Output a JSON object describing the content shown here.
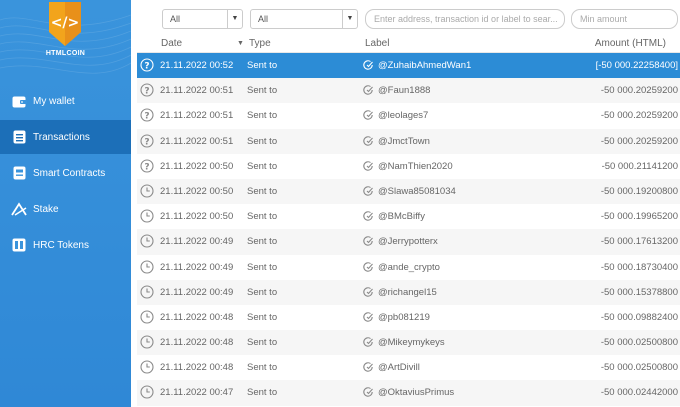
{
  "app": {
    "brand": "HTMLCOIN",
    "accent": "#2f88d6",
    "selected_row_color": "#2c8cd6"
  },
  "sidebar": {
    "items": [
      {
        "label": "My wallet",
        "icon": "wallet-icon"
      },
      {
        "label": "Transactions",
        "icon": "transactions-icon",
        "active": true
      },
      {
        "label": "Smart Contracts",
        "icon": "smart-contracts-icon"
      },
      {
        "label": "Stake",
        "icon": "stake-icon"
      },
      {
        "label": "HRC Tokens",
        "icon": "tokens-icon"
      }
    ]
  },
  "filters": {
    "date_filter": "All",
    "type_filter": "All",
    "search_placeholder": "Enter address, transaction id or label to sear...",
    "min_amount_placeholder": "Min amount"
  },
  "table": {
    "columns": {
      "date": "Date",
      "type": "Type",
      "label": "Label",
      "amount": "Amount (HTML)"
    },
    "rows": [
      {
        "status": "unconfirmed-icon",
        "date": "21.11.2022 00:52",
        "type": "Sent to",
        "label": "@ZuhaibAhmedWan1",
        "amount": "[-50 000.22258400]",
        "selected": true
      },
      {
        "status": "unconfirmed-icon",
        "date": "21.11.2022 00:51",
        "type": "Sent to",
        "label": "@Faun1888",
        "amount": "-50 000.20259200"
      },
      {
        "status": "unconfirmed-icon",
        "date": "21.11.2022 00:51",
        "type": "Sent to",
        "label": "@leolages7",
        "amount": "-50 000.20259200"
      },
      {
        "status": "unconfirmed-icon",
        "date": "21.11.2022 00:51",
        "type": "Sent to",
        "label": "@JmctTown",
        "amount": "-50 000.20259200"
      },
      {
        "status": "unconfirmed-icon",
        "date": "21.11.2022 00:50",
        "type": "Sent to",
        "label": "@NamThien2020",
        "amount": "-50 000.21141200"
      },
      {
        "status": "clock-icon",
        "date": "21.11.2022 00:50",
        "type": "Sent to",
        "label": "@Slawa85081034",
        "amount": "-50 000.19200800"
      },
      {
        "status": "clock-icon",
        "date": "21.11.2022 00:50",
        "type": "Sent to",
        "label": "@BMcBiffy",
        "amount": "-50 000.19965200"
      },
      {
        "status": "clock-icon",
        "date": "21.11.2022 00:49",
        "type": "Sent to",
        "label": "@Jerrypotterx",
        "amount": "-50 000.17613200"
      },
      {
        "status": "clock-icon",
        "date": "21.11.2022 00:49",
        "type": "Sent to",
        "label": "@ande_crypto",
        "amount": "-50 000.18730400"
      },
      {
        "status": "clock-icon",
        "date": "21.11.2022 00:49",
        "type": "Sent to",
        "label": "@richangel15",
        "amount": "-50 000.15378800"
      },
      {
        "status": "clock-icon",
        "date": "21.11.2022 00:48",
        "type": "Sent to",
        "label": "@pb081219",
        "amount": "-50 000.09882400"
      },
      {
        "status": "clock-icon",
        "date": "21.11.2022 00:48",
        "type": "Sent to",
        "label": "@Mikeymykeys",
        "amount": "-50 000.02500800"
      },
      {
        "status": "clock-icon",
        "date": "21.11.2022 00:48",
        "type": "Sent to",
        "label": "@ArtDivill",
        "amount": "-50 000.02500800"
      },
      {
        "status": "clock-icon",
        "date": "21.11.2022 00:47",
        "type": "Sent to",
        "label": "@OktaviusPrimus",
        "amount": "-50 000.02442000"
      }
    ]
  }
}
